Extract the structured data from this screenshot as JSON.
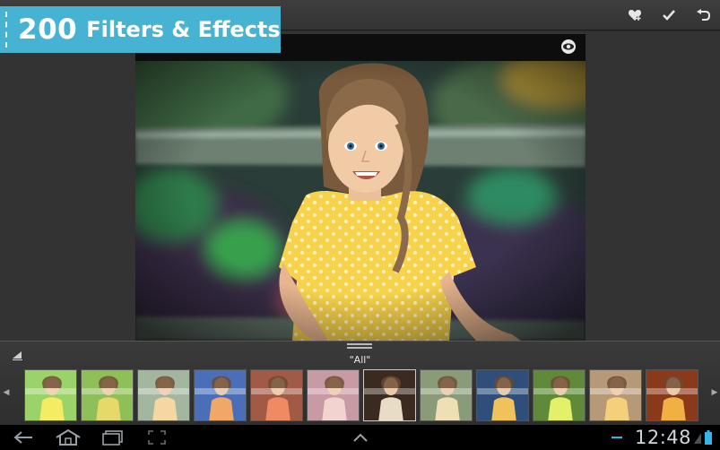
{
  "banner": {
    "number": "200",
    "text": "Filters & Effects"
  },
  "toolbar": {
    "favorite_icon": "heart-plus-icon",
    "apply_icon": "checkmark-icon",
    "undo_icon": "undo-arrow-icon"
  },
  "photo": {
    "compare_icon": "eye-icon"
  },
  "panel": {
    "category": "\"All\"",
    "thumbnails": [
      {
        "tint": "#9bd26a",
        "accent": "#f4ec63"
      },
      {
        "tint": "#8fbf58",
        "accent": "#e6d96a"
      },
      {
        "tint": "#a3b7a0",
        "accent": "#f5d7a2"
      },
      {
        "tint": "#4a6fb8",
        "accent": "#f0a768"
      },
      {
        "tint": "#a05a45",
        "accent": "#f08a62"
      },
      {
        "tint": "#c89aa4",
        "accent": "#f3d3cf"
      },
      {
        "tint": "#3a2a1f",
        "accent": "#e9dcc7"
      },
      {
        "tint": "#8a9b7a",
        "accent": "#eee0b4"
      },
      {
        "tint": "#2f4f7a",
        "accent": "#f1c25a"
      },
      {
        "tint": "#5e8a3a",
        "accent": "#e3f06a"
      },
      {
        "tint": "#b69a78",
        "accent": "#f5cf7a"
      },
      {
        "tint": "#8a3a1a",
        "accent": "#f0b043"
      }
    ]
  },
  "system": {
    "time": "12:48"
  },
  "colors": {
    "banner": "#46b3d3",
    "battery": "#33b5e5"
  }
}
